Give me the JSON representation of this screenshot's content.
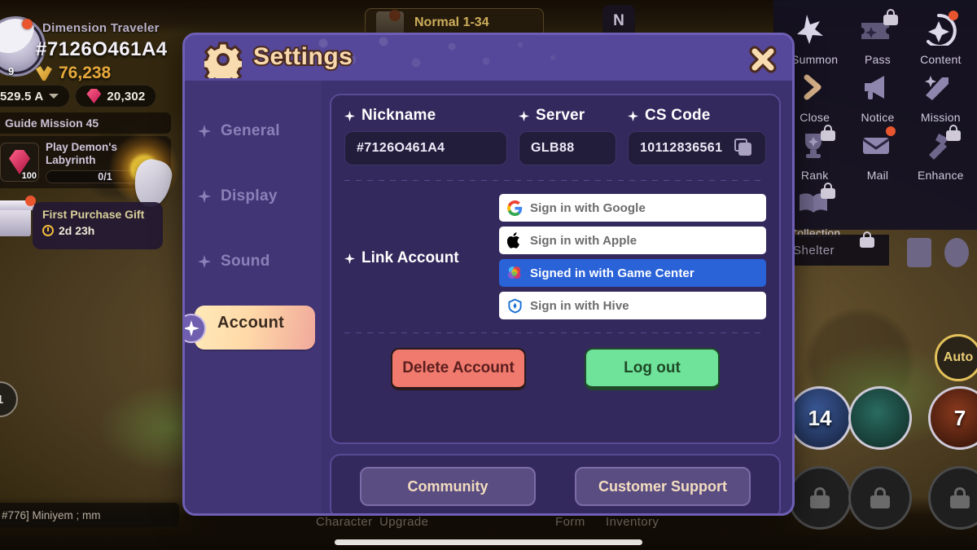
{
  "game": {
    "player": {
      "title": "Dimension Traveler",
      "uid": "#7126O461A4",
      "gold": "76,238",
      "level": "9",
      "power": "529.5 A",
      "gems": "20,302"
    },
    "guide": {
      "header": "Guide Mission 45",
      "task": "Play Demon's Labyrinth",
      "progress": "0/1",
      "reward_qty": "100"
    },
    "gift": {
      "title": "First Purchase Gift",
      "timer": "2d 23h"
    },
    "stage": {
      "label": "Normal 1-34",
      "badge": "N"
    },
    "chat": "#776] Miniyem ; mm",
    "right_menu": [
      {
        "label": "Summon",
        "icon": "stars-icon",
        "locked": false,
        "badge": false
      },
      {
        "label": "Pass",
        "icon": "ticket-icon",
        "locked": true,
        "badge": false
      },
      {
        "label": "Content",
        "icon": "compass-star-icon",
        "locked": false,
        "badge": true
      },
      {
        "label": "Close",
        "icon": "chevron-right-icon",
        "locked": false,
        "badge": false
      },
      {
        "label": "Notice",
        "icon": "megaphone-icon",
        "locked": false,
        "badge": false
      },
      {
        "label": "Mission",
        "icon": "quill-icon",
        "locked": false,
        "badge": false
      },
      {
        "label": "Rank",
        "icon": "trophy-icon",
        "locked": true,
        "badge": false
      },
      {
        "label": "Mail",
        "icon": "envelope-icon",
        "locked": false,
        "badge": true
      },
      {
        "label": "Enhance",
        "icon": "hammer-icon",
        "locked": true,
        "badge": false
      },
      {
        "label": "Collection",
        "icon": "book-icon",
        "locked": true,
        "badge": false
      }
    ],
    "shelter": {
      "label": "Shelter",
      "locked": true
    },
    "skills": {
      "left_count": "14",
      "right_count": "7",
      "auto_label": "Auto"
    },
    "bottom_nav": [
      "Character",
      "Upgrade",
      "Form",
      "Inventory"
    ],
    "edge_badges": [
      "1"
    ]
  },
  "modal": {
    "title": "Settings",
    "gear_icon": "gear-icon",
    "close_icon": "close-icon",
    "sidebar": [
      {
        "label": "General",
        "active": false
      },
      {
        "label": "Display",
        "active": false
      },
      {
        "label": "Sound",
        "active": false
      },
      {
        "label": "Account",
        "active": true
      }
    ],
    "account": {
      "fields": [
        {
          "label": "Nickname",
          "value": "#7126O461A4",
          "copy": false
        },
        {
          "label": "Server",
          "value": "GLB88",
          "copy": false
        },
        {
          "label": "CS Code",
          "value": "10112836561",
          "copy": true
        }
      ],
      "link_label": "Link Account",
      "link_accounts": [
        {
          "label": "Sign in with Google",
          "icon": "google-icon",
          "active": false
        },
        {
          "label": "Sign in with Apple",
          "icon": "apple-icon",
          "active": false
        },
        {
          "label": "Signed in with Game Center",
          "icon": "gamecenter-icon",
          "active": true
        },
        {
          "label": "Sign in with Hive",
          "icon": "hive-icon",
          "active": false
        }
      ],
      "actions": [
        {
          "label": "Delete Account",
          "style": "danger"
        },
        {
          "label": "Log out",
          "style": "confirm"
        }
      ]
    },
    "links": [
      {
        "label": "Community"
      },
      {
        "label": "Customer Support"
      }
    ]
  },
  "colors": {
    "modal_bg": "#3c3270",
    "modal_border": "#6e5fb4",
    "header": "#554799",
    "title_text": "#f8d9ae",
    "card_bg": "#33295c",
    "field_bg": "#231d3c",
    "accent_active": "#2a62d8",
    "danger": "#f07a6d",
    "confirm": "#6fe39a",
    "sidebar_active_from": "#ffe9b8",
    "sidebar_active_to": "#f0a99b"
  }
}
